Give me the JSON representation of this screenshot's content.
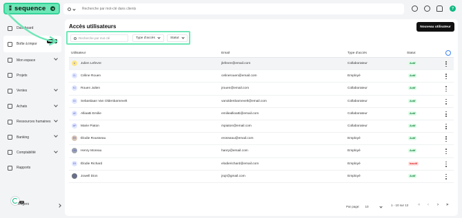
{
  "brand": {
    "name": "sequence",
    "mark": "⁑"
  },
  "topbar": {
    "search_placeholder": "Recherche par mot-clé dans clients",
    "help": "?"
  },
  "sidebar": {
    "items": [
      {
        "label": "Dashboard",
        "icon": "home-icon",
        "chev": false,
        "active": false
      },
      {
        "label": "Boîte à impor",
        "icon": "inbox-icon",
        "chev": false,
        "active": true,
        "badge": "No... ⁿ"
      },
      {
        "label": "Mon espace",
        "icon": "user-icon",
        "chev": true
      },
      {
        "label": "Projets",
        "icon": "check-square-icon",
        "chev": false
      },
      {
        "label": "Ventes",
        "icon": "cart-icon",
        "chev": true
      },
      {
        "label": "Achats",
        "icon": "receipt-icon",
        "chev": true
      },
      {
        "label": "Ressources humaines",
        "icon": "people-icon",
        "chev": true
      },
      {
        "label": "Banking",
        "icon": "bank-icon",
        "chev": true
      },
      {
        "label": "Comptabilité",
        "icon": "ledger-icon",
        "chev": true
      },
      {
        "label": "Rapports",
        "icon": "chart-icon",
        "chev": false
      }
    ],
    "user": {
      "name": "Rogers",
      "count": "5B"
    }
  },
  "page": {
    "title": "Accès utilisateurs",
    "new_button": "Nouveau utilisateur",
    "filter_search_placeholder": "Recherche par mot clé",
    "filter_type": "Type d'accès",
    "filter_status": "Statut"
  },
  "table": {
    "headers": {
      "user": "Utilisateur",
      "email": "Email",
      "type": "Type d'accès",
      "status": "Statut"
    },
    "rows": [
      {
        "name": "Julien Lefevre",
        "initials": "★",
        "email": "jlefevre@email.com",
        "type": "Collaborateur",
        "status": "Actif"
      },
      {
        "name": "Céline Rouen",
        "initials": "CL",
        "email": "celinerouen@email.com",
        "type": "Employé",
        "status": "Actif"
      },
      {
        "name": "Rouen Julien",
        "initials": "RJ",
        "email": "jrouen@email.com",
        "type": "Collaborateur",
        "status": "Actif"
      },
      {
        "name": "Sebastiaan Van Oldenbarnevelt",
        "initials": "SV",
        "email": "vanoldenbarnevelt@email.com",
        "type": "Collaborateur",
        "status": "Actif"
      },
      {
        "name": "Alliaatti Emilie",
        "initials": "AE",
        "email": "emilieallioatti@email.com",
        "type": "Collaborateur",
        "status": "Actif"
      },
      {
        "name": "Marie Piaton",
        "initials": "MP",
        "email": "mpiaton@email.com",
        "type": "Collaborateur",
        "status": "Actif"
      },
      {
        "name": "Élodie Rousseau",
        "initials": "ÉR",
        "email": "erosseau@email.com",
        "type": "Employé",
        "status": "Actif"
      },
      {
        "name": "Henry Moreau",
        "initials": "HM",
        "email": "hanry@email.com",
        "type": "Employé",
        "status": "Actif"
      },
      {
        "name": "Élodie Richard",
        "initials": "ER",
        "email": "elodierichard@email.com",
        "type": "Employé",
        "status": "Inactif"
      },
      {
        "name": "Jowell Dion",
        "initials": "JD",
        "email": "jrujr@gmail.com",
        "type": "Employé",
        "status": "Actif"
      }
    ]
  },
  "pagination": {
    "per_page_label": "Par page:",
    "per_page": "10",
    "range": "1 - 10 sur 12"
  },
  "colors": {
    "accent": "#34d399",
    "active_bg": "#dcfce7",
    "active_fg": "#15803d",
    "inactive_bg": "#fee2e2",
    "inactive_fg": "#dc2626"
  }
}
